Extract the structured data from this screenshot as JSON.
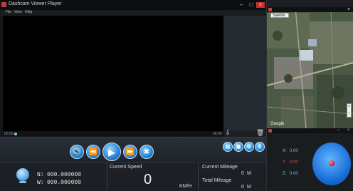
{
  "window": {
    "title": "Dashcam Viewer Player",
    "controls": {
      "minimize": "–",
      "maximize": "□",
      "close": "×"
    }
  },
  "menu": {
    "items": [
      "File",
      "View",
      "Help"
    ]
  },
  "playback": {
    "time_start": "00:00",
    "time_end": "00:00",
    "buttons": {
      "volume": "volume-icon",
      "rewind": "rewind-icon",
      "play": "play-icon",
      "forward": "fast-forward-icon",
      "stop": "stop-icon"
    }
  },
  "side": {
    "icons": [
      "import-icon",
      "delete-icon"
    ]
  },
  "tools": {
    "icons": [
      "file-icon",
      "photo-icon",
      "settings-icon",
      "info-icon"
    ]
  },
  "gps": {
    "north_label": "N:",
    "north_value": "000.000000",
    "west_label": "W:",
    "west_value": "000.000000"
  },
  "speed": {
    "label": "Current Speed",
    "value": "0",
    "unit": "KM/H"
  },
  "mileage": {
    "current_label": "Current Mileage",
    "current_value": "0",
    "current_unit": "M",
    "total_label": "Total Mileage",
    "total_value": "0",
    "total_unit": "M"
  },
  "map": {
    "type_select": "Satellite",
    "logo": "Google",
    "zoom_in": "+",
    "zoom_out": "–"
  },
  "sensor": {
    "x_label": "X:",
    "x_value": "0.00",
    "y_label": "Y:",
    "y_value": "0.00",
    "z_label": "Z:",
    "z_value": "0.00"
  },
  "colors": {
    "accent": "#1e7ad0",
    "sensor_y": "#e04848",
    "sensor_xz": "#7bd36a"
  }
}
